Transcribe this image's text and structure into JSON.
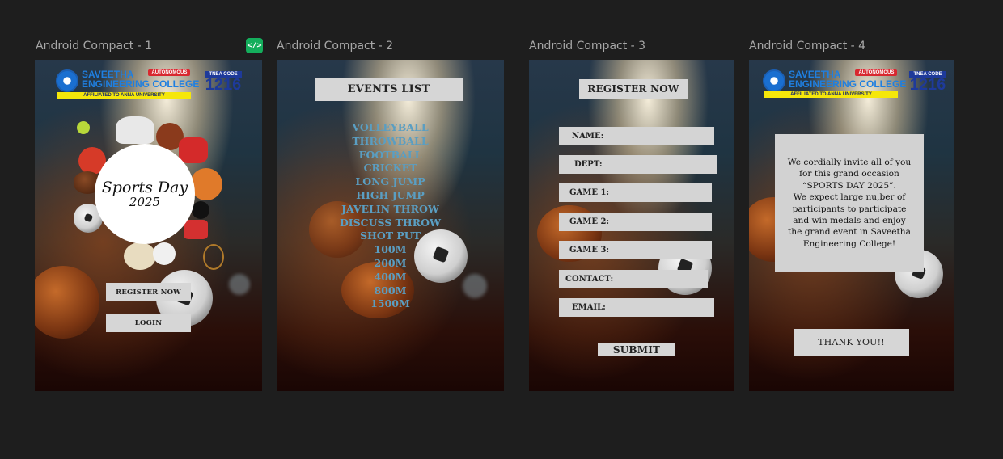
{
  "canvas": {
    "frames": [
      {
        "label": "Android Compact - 1"
      },
      {
        "label": "Android Compact - 2"
      },
      {
        "label": "Android Compact - 3"
      },
      {
        "label": "Android Compact - 4"
      }
    ],
    "code_badge": "</>"
  },
  "college": {
    "name_line1": "SAVEETHA",
    "name_line2": "ENGINEERING COLLEGE",
    "autonomous": "AUTONOMOUS",
    "affiliated": "AFFILIATED TO ANNA UNIVERSITY",
    "tnea_label": "TNEA CODE",
    "tnea_code": "1216"
  },
  "screen1": {
    "title_line1": "Sports Day",
    "title_line2": "2025",
    "register_button": "REGISTER NOW",
    "login_button": "LOGIN"
  },
  "screen2": {
    "header": "EVENTS LIST",
    "events": [
      "VOLLEYBALL",
      "THROWBALL",
      "FOOTBALL",
      "CRICKET",
      "LONG JUMP",
      "HIGH JUMP",
      "JAVELIN THROW",
      "DISCUSS THROW",
      "SHOT PUT",
      "100M",
      "200M",
      "400M",
      "800M",
      "1500M"
    ]
  },
  "screen3": {
    "header": "REGISTER NOW",
    "fields": [
      "NAME:",
      "DEPT:",
      "GAME 1:",
      "GAME 2:",
      "GAME 3:",
      "CONTACT:",
      "EMAIL:"
    ],
    "submit": "SUBMIT"
  },
  "screen4": {
    "invite_lines": [
      "We cordially invite all of  you",
      "for this grand occasion",
      "“SPORTS DAY 2025”.",
      "We expect large nu,ber of",
      "participants to participate",
      "and win medals and enjoy",
      "the grand event in Saveetha",
      "Engineering College!"
    ],
    "thank_you_button": "THANK YOU!!"
  },
  "colors": {
    "canvas_bg": "#1e1e1e",
    "events_text": "#5a9ec2",
    "button_bg": "#d6d6d6",
    "badge_green": "#14ae5c"
  }
}
